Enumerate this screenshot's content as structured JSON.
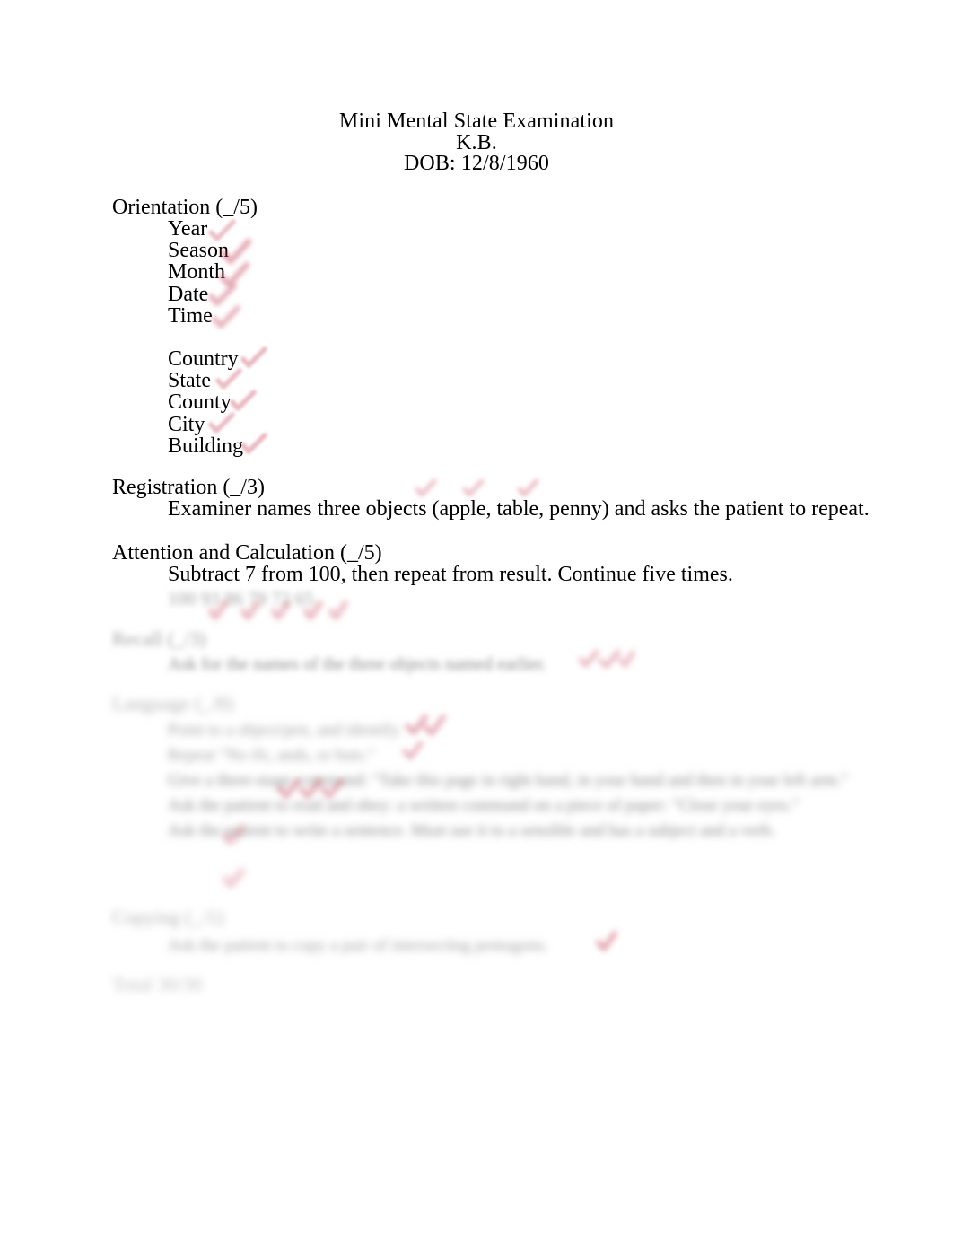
{
  "document": {
    "title": "Mini Mental State Examination",
    "patient_initials": "K.B.",
    "dob_line": "DOB: 12/8/1960"
  },
  "sections": {
    "orientation": {
      "heading": "Orientation (_/5)",
      "time_items": [
        "Year",
        "Season",
        "Month",
        "Date",
        "Time"
      ],
      "place_items": [
        "Country",
        "State",
        "County",
        "City",
        "Building"
      ]
    },
    "registration": {
      "heading": "Registration (_/3)",
      "instruction": "Examiner names three objects (apple, table, penny) and asks the patient to repeat."
    },
    "attention": {
      "heading": "Attention and Calculation (_/5)",
      "instruction": "Subtract 7 from 100, then repeat from result. Continue five times.",
      "answers": "100  93  86  79  72  65"
    },
    "recall": {
      "heading": "Recall (_/3)",
      "instruction": "Ask for the names of the three objects named earlier."
    },
    "language": {
      "heading": "Language (_/8)",
      "lines": [
        "Point to a object/pen, and identify.",
        "Repeat \"No ifs, ands, or buts.\"",
        "Give a three-stage command: \"Take this page in right hand, in your hand and then in your left arm.\"",
        "Ask the patient to read and obey: a written command on a piece of paper: \"Close your eyes.\"",
        "Ask the patient to write a sentence. Must use it to a sensible and has a subject and a verb."
      ]
    },
    "copying": {
      "heading": "Copying (_/1)",
      "instruction": "Ask the patient to copy a pair of intersecting pentagons."
    },
    "total": {
      "label": "Total 30/30"
    }
  },
  "annotations": {
    "color": "#c0304a",
    "description": "handwritten red check marks scoring each item"
  }
}
